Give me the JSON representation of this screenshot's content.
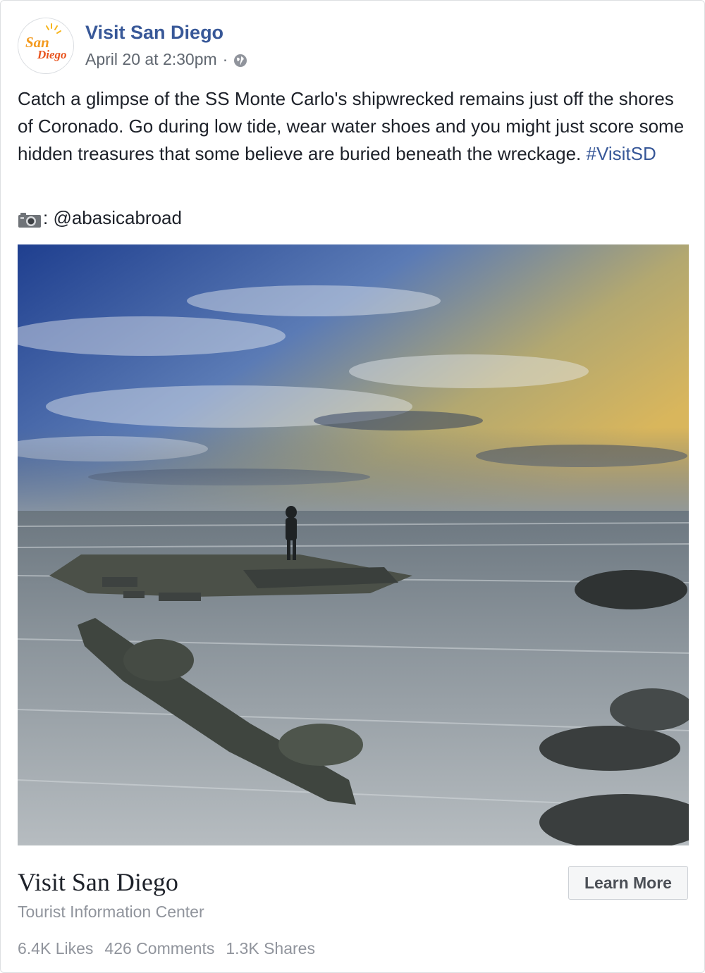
{
  "post": {
    "page_name": "Visit San Diego",
    "timestamp": "April 20 at 2:30pm",
    "separator": "·",
    "privacy_icon": "globe-icon",
    "avatar_logo_text_top": "San",
    "avatar_logo_text_bottom": "Diego",
    "text_body": "Catch a glimpse of the SS Monte Carlo's shipwrecked remains just off the shores of Coronado. Go during low tide, wear water shoes and you might just score some hidden treasures that some believe are buried beneath the wreckage. ",
    "hashtag": "#VisitSD",
    "credit_icon": "camera-icon",
    "credit_text": ": @abasicabroad"
  },
  "attachment": {
    "title": "Visit San Diego",
    "subtitle": "Tourist Information Center",
    "button_label": "Learn More"
  },
  "stats": {
    "likes": "6.4K Likes",
    "comments": "426 Comments",
    "shares": "1.3K Shares"
  },
  "colors": {
    "link_blue": "#385898",
    "text": "#1d2129",
    "secondary": "#606770",
    "muted": "#90949c",
    "logo_orange": "#f39a1e"
  }
}
